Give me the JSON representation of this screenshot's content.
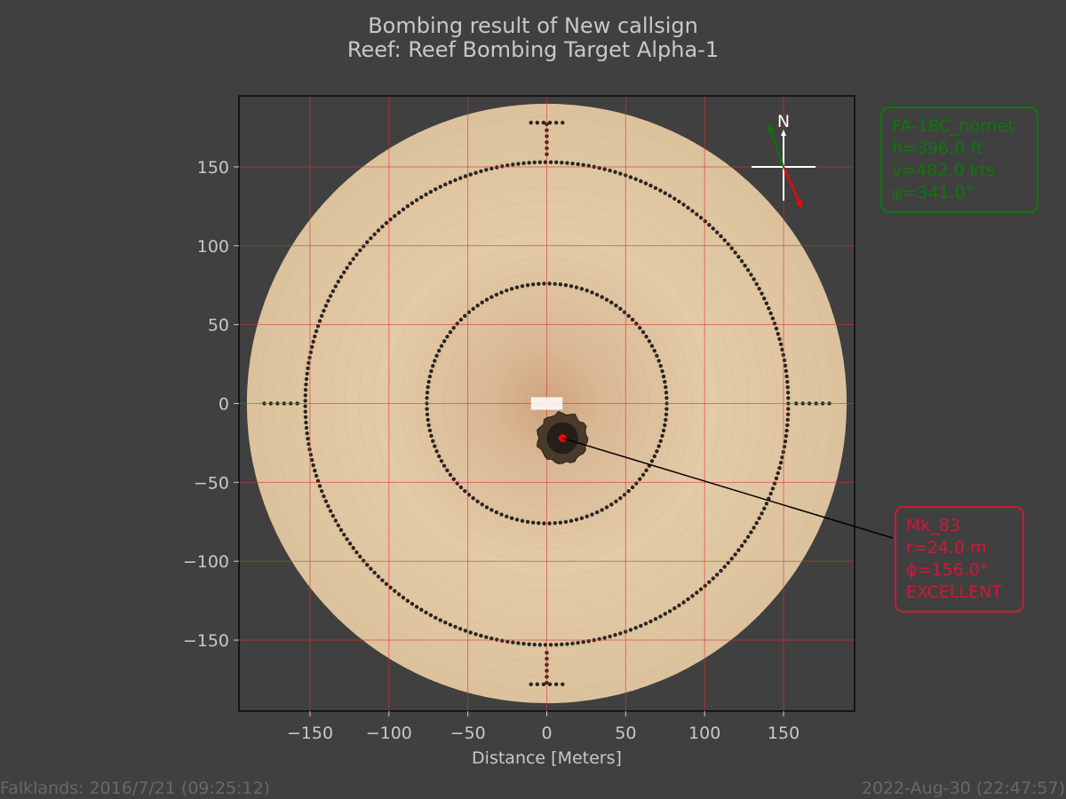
{
  "chart_data": {
    "type": "scatter",
    "title_line1": "Bombing result of New callsign",
    "title_line2": "Reef: Reef Bombing Target Alpha-1",
    "xlabel": "Distance [Meters]",
    "ylabel": "",
    "xlim": [
      -195,
      195
    ],
    "ylim": [
      -195,
      195
    ],
    "xticks": [
      -150,
      -100,
      -50,
      0,
      50,
      100,
      150
    ],
    "yticks": [
      -150,
      -100,
      -50,
      0,
      50,
      100,
      150
    ],
    "xtick_labels": [
      "−150",
      "−100",
      "−50",
      "0",
      "50",
      "100",
      "150"
    ],
    "ytick_labels": [
      "−150",
      "−100",
      "−50",
      "0",
      "50",
      "100",
      "150"
    ],
    "grid": true,
    "grid_color": "#e03030",
    "target": {
      "outer_radius": 190,
      "dotted_rings": [
        76,
        153
      ],
      "cross_marks": true
    },
    "impact": {
      "x": 10,
      "y": -22,
      "color": "#ff0000"
    },
    "compass": {
      "label": "N",
      "heading_arrow_deg": 341,
      "heading_arrow_color": "#107010",
      "bomb_arrow_deg": 156,
      "bomb_arrow_color": "#ff0000"
    },
    "aircraft_box": {
      "lines": [
        "FA-18C_hornet",
        "h=396.0 ft",
        "v=482.0 kts",
        "ψ=341.0°"
      ],
      "color": "#0a7a0a"
    },
    "weapon_box": {
      "lines": [
        "Mk_83",
        "r=24.0 m",
        "ϕ=156.0°",
        "EXCELLENT"
      ],
      "color": "#d01838"
    }
  },
  "footer": {
    "left": "Falklands: 2016/7/21 (09:25:12)",
    "right": "2022-Aug-30 (22:47:57)"
  }
}
